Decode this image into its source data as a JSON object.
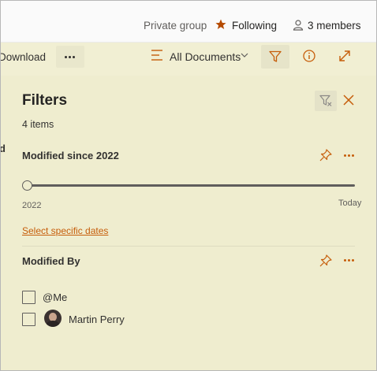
{
  "header": {
    "privacy": "Private group",
    "following": "Following",
    "members": "3 members"
  },
  "commandbar": {
    "download": "Download",
    "view": "All Documents"
  },
  "left_fragment": "d",
  "filters": {
    "title": "Filters",
    "count": "4 items",
    "sections": [
      {
        "title": "Modified since 2022",
        "slider_min": "2022",
        "slider_max": "Today",
        "link": "Select specific dates"
      },
      {
        "title": "Modified By",
        "options": [
          {
            "label": "@Me",
            "checked": false
          },
          {
            "label": "Martin Perry",
            "checked": false
          }
        ]
      }
    ]
  },
  "colors": {
    "accent": "#c65d0a",
    "panel_bg": "#efedcf",
    "cmdbar_bg": "#f1efd3"
  }
}
